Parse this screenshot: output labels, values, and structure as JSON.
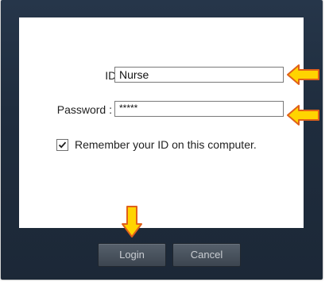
{
  "form": {
    "id_label": "ID :",
    "id_value": "Nurse",
    "password_label": "Password :",
    "password_value": "*****",
    "remember_label": "Remember your ID on this computer.",
    "remember_checked": true
  },
  "buttons": {
    "login_label": "Login",
    "cancel_label": "Cancel"
  },
  "annotations": {
    "arrow_color": "#ffd400",
    "arrow_outline": "#e0601a"
  }
}
